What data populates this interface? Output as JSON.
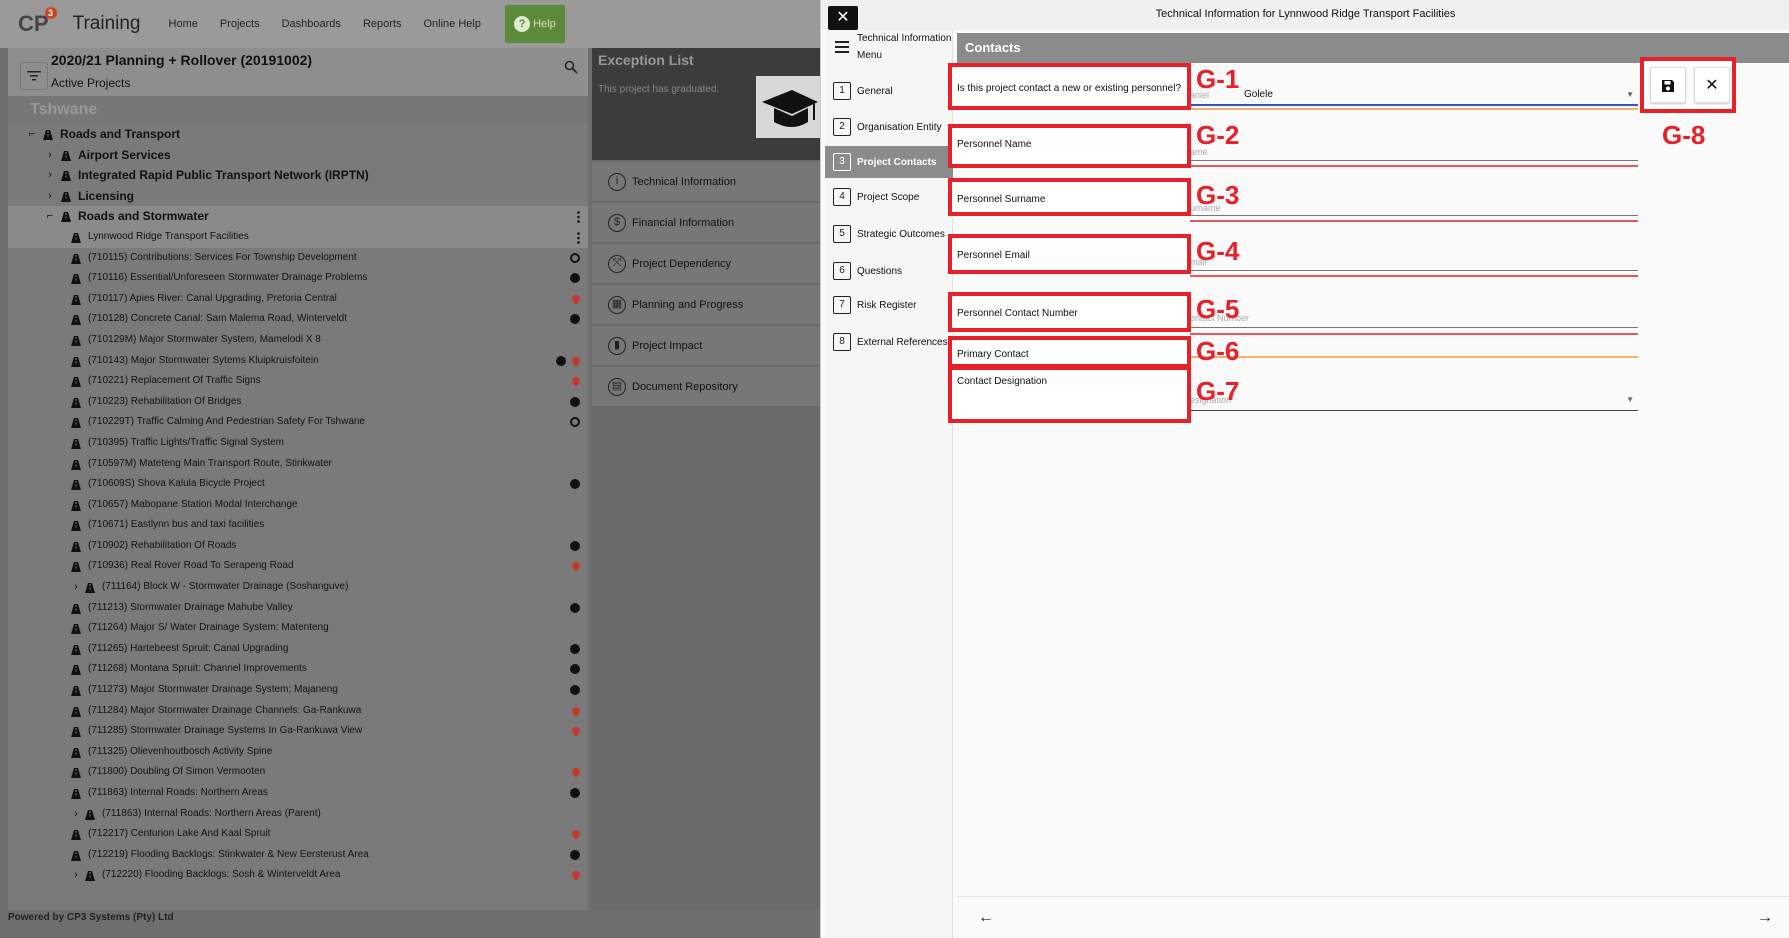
{
  "app": {
    "logo": "CP",
    "logo_sup": "3",
    "title": "Training",
    "nav": [
      "Home",
      "Projects",
      "Dashboards",
      "Reports",
      "Online Help"
    ],
    "help_label": "Help",
    "footer": "Powered by CP3 Systems (Pty) Ltd"
  },
  "project_header": {
    "title": "2020/21 Planning + Rollover (20191002)",
    "subtitle": "Active Projects"
  },
  "tree": {
    "region": "Tshwane",
    "rows": [
      {
        "level": 0,
        "exp": "-",
        "label": "Roads and Transport",
        "status": ""
      },
      {
        "level": 1,
        "exp": ">",
        "label": "Airport Services",
        "status": ""
      },
      {
        "level": 1,
        "exp": ">",
        "label": "Integrated Rapid Public Transport Network (IRPTN)",
        "status": ""
      },
      {
        "level": 1,
        "exp": ">",
        "label": "Licensing",
        "status": ""
      },
      {
        "level": 1,
        "exp": "-",
        "label": "Roads and Stormwater",
        "status": "dots",
        "hl": true
      },
      {
        "level": 2,
        "exp": "",
        "label": "Lynnwood Ridge Transport Facilities",
        "status": "dots",
        "hl": true
      },
      {
        "level": 2,
        "exp": "",
        "label": "(710115) Contributions: Services For Township Development",
        "status": "ring"
      },
      {
        "level": 2,
        "exp": "",
        "label": "(710116) Essential/Unforeseen Stormwater Drainage Problems",
        "status": "ok"
      },
      {
        "level": 2,
        "exp": "",
        "label": "(710117) Apies River: Canal Upgrading, Pretoria Central",
        "status": "red"
      },
      {
        "level": 2,
        "exp": "",
        "label": "(710128) Concrete Canal: Sam Malema Road, Winterveldt",
        "status": "ok"
      },
      {
        "level": 2,
        "exp": "",
        "label": "(710129M) Major Stormwater System, Mamelodi X 8",
        "status": ""
      },
      {
        "level": 2,
        "exp": "",
        "label": "(710143) Major Stormwater Sytems Kluipkruisfoitein",
        "status": "okred"
      },
      {
        "level": 2,
        "exp": "",
        "label": "(710221) Replacement Of Traffic Signs",
        "status": "red"
      },
      {
        "level": 2,
        "exp": "",
        "label": "(710223) Rehabilitation Of Bridges",
        "status": "ok"
      },
      {
        "level": 2,
        "exp": "",
        "label": "(710229T) Traffic Calming And Pedestrian Safety For Tshwane",
        "status": "ring"
      },
      {
        "level": 2,
        "exp": "",
        "label": "(710395) Traffic Lights/Traffic Signal System",
        "status": ""
      },
      {
        "level": 2,
        "exp": "",
        "label": "(710597M) Mateteng Main Transport Route, Stinkwater",
        "status": ""
      },
      {
        "level": 2,
        "exp": "",
        "label": "(710609S) Shova Kalula Bicycle Project",
        "status": "ok"
      },
      {
        "level": 2,
        "exp": "",
        "label": "(710657) Mabopane Station Modal Interchange",
        "status": ""
      },
      {
        "level": 2,
        "exp": "",
        "label": "(710671) Eastlynn bus and taxi facilities",
        "status": ""
      },
      {
        "level": 2,
        "exp": "",
        "label": "(710902) Rehabilitation Of Roads",
        "status": "ok"
      },
      {
        "level": 2,
        "exp": "",
        "label": "(710936) Real Rover Road To Serapeng Road",
        "status": "red"
      },
      {
        "level": 2,
        "exp": ">",
        "label": "(711164) Block W - Stormwater Drainage (Soshanguve)",
        "status": ""
      },
      {
        "level": 2,
        "exp": "",
        "label": "(711213) Stormwater Drainage Mahube Valley",
        "status": "ok"
      },
      {
        "level": 2,
        "exp": "",
        "label": "(711264) Major S/ Water Drainage System: Matenteng",
        "status": ""
      },
      {
        "level": 2,
        "exp": "",
        "label": "(711265) Hartebeest Spruit: Canal Upgrading",
        "status": "ok"
      },
      {
        "level": 2,
        "exp": "",
        "label": "(711268) Montana Spruit: Channel Improvements",
        "status": "ok"
      },
      {
        "level": 2,
        "exp": "",
        "label": "(711273) Major Stormwater Drainage System; Majaneng",
        "status": "ok"
      },
      {
        "level": 2,
        "exp": "",
        "label": "(711284) Major Stormwater Drainage Channels: Ga-Rankuwa",
        "status": "red"
      },
      {
        "level": 2,
        "exp": "",
        "label": "(711285) Stormwater Drainage Systems In Ga-Rankuwa View",
        "status": "red"
      },
      {
        "level": 2,
        "exp": "",
        "label": "(711325) Olievenhoutbosch Activity Spine",
        "status": ""
      },
      {
        "level": 2,
        "exp": "",
        "label": "(711800) Doubling Of Simon Vermooten",
        "status": "red"
      },
      {
        "level": 2,
        "exp": "",
        "label": "(711863) Internal Roads: Northern Areas",
        "status": "ok"
      },
      {
        "level": 2,
        "exp": ">",
        "label": "(711863) Internal Roads: Northern Areas (Parent)",
        "status": ""
      },
      {
        "level": 2,
        "exp": "",
        "label": "(712217) Centurion Lake And Kaal Spruit",
        "status": "red"
      },
      {
        "level": 2,
        "exp": "",
        "label": "(712219) Flooding Backlogs: Stinkwater & New Eersterust Area",
        "status": "ok"
      },
      {
        "level": 2,
        "exp": ">",
        "label": "(712220) Flooding Backlogs: Sosh & Winterveldt Area",
        "status": "red"
      }
    ]
  },
  "exception": {
    "title": "Exception List",
    "text": "This project has graduated."
  },
  "side_menu": [
    {
      "label": "Technical Information",
      "icon": "info-icon"
    },
    {
      "label": "Financial Information",
      "icon": "dollar-icon"
    },
    {
      "label": "Project Dependency",
      "icon": "dependency-icon"
    },
    {
      "label": "Planning and Progress",
      "icon": "calendar-icon"
    },
    {
      "label": "Project Impact",
      "icon": "chart-icon"
    },
    {
      "label": "Document Repository",
      "icon": "document-icon"
    }
  ],
  "dialog": {
    "close": "✕",
    "title": "Technical Information for Lynnwood Ridge Transport Facilities",
    "menu_header": "Technical Information Menu",
    "menu": [
      {
        "num": "1",
        "label": "General"
      },
      {
        "num": "2",
        "label": "Organisation Entity"
      },
      {
        "num": "3",
        "label": "Project Contacts",
        "active": true
      },
      {
        "num": "4",
        "label": "Project Scope"
      },
      {
        "num": "5",
        "label": "Strategic Outcomes"
      },
      {
        "num": "6",
        "label": "Questions"
      },
      {
        "num": "7",
        "label": "Risk Register"
      },
      {
        "num": "8",
        "label": "External References"
      }
    ],
    "section_title": "Contacts",
    "fields": {
      "new_existing": {
        "label": "Is this project contact a new or existing personnel?",
        "ghost": "aniel",
        "value": "Golele",
        "tag": "G-1"
      },
      "name": {
        "label": "Personnel Name",
        "ghost": "ame",
        "tag": "G-2"
      },
      "surname": {
        "label": "Personnel Surname",
        "ghost": "urname",
        "tag": "G-3"
      },
      "email": {
        "label": "Personnel Email",
        "ghost": "mail",
        "tag": "G-4"
      },
      "contact_number": {
        "label": "Personnel Contact Number",
        "ghost": "ontact Number",
        "tag": "G-5"
      },
      "primary": {
        "label": "Primary Contact",
        "tag": "G-6"
      },
      "designation": {
        "label": "Contact Designation",
        "ghost": "esignation",
        "tag": "G-7"
      }
    },
    "actions_tag": "G-8"
  },
  "colors": {
    "annotation": "#e8202a",
    "active_menu": "#8b8b8b",
    "underline_red": "#e05a5a",
    "underline_orange": "#f0b070",
    "underline_blue": "#3a4fc0"
  }
}
